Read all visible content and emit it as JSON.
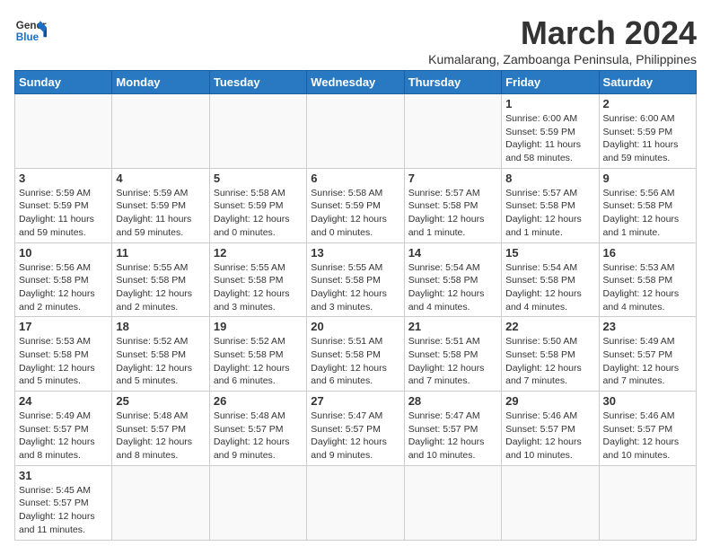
{
  "header": {
    "logo_general": "General",
    "logo_blue": "Blue",
    "title": "March 2024",
    "subtitle": "Kumalarang, Zamboanga Peninsula, Philippines"
  },
  "weekdays": [
    "Sunday",
    "Monday",
    "Tuesday",
    "Wednesday",
    "Thursday",
    "Friday",
    "Saturday"
  ],
  "weeks": [
    [
      {
        "day": "",
        "info": ""
      },
      {
        "day": "",
        "info": ""
      },
      {
        "day": "",
        "info": ""
      },
      {
        "day": "",
        "info": ""
      },
      {
        "day": "",
        "info": ""
      },
      {
        "day": "1",
        "info": "Sunrise: 6:00 AM\nSunset: 5:59 PM\nDaylight: 11 hours\nand 58 minutes."
      },
      {
        "day": "2",
        "info": "Sunrise: 6:00 AM\nSunset: 5:59 PM\nDaylight: 11 hours\nand 59 minutes."
      }
    ],
    [
      {
        "day": "3",
        "info": "Sunrise: 5:59 AM\nSunset: 5:59 PM\nDaylight: 11 hours\nand 59 minutes."
      },
      {
        "day": "4",
        "info": "Sunrise: 5:59 AM\nSunset: 5:59 PM\nDaylight: 11 hours\nand 59 minutes."
      },
      {
        "day": "5",
        "info": "Sunrise: 5:58 AM\nSunset: 5:59 PM\nDaylight: 12 hours\nand 0 minutes."
      },
      {
        "day": "6",
        "info": "Sunrise: 5:58 AM\nSunset: 5:59 PM\nDaylight: 12 hours\nand 0 minutes."
      },
      {
        "day": "7",
        "info": "Sunrise: 5:57 AM\nSunset: 5:58 PM\nDaylight: 12 hours\nand 1 minute."
      },
      {
        "day": "8",
        "info": "Sunrise: 5:57 AM\nSunset: 5:58 PM\nDaylight: 12 hours\nand 1 minute."
      },
      {
        "day": "9",
        "info": "Sunrise: 5:56 AM\nSunset: 5:58 PM\nDaylight: 12 hours\nand 1 minute."
      }
    ],
    [
      {
        "day": "10",
        "info": "Sunrise: 5:56 AM\nSunset: 5:58 PM\nDaylight: 12 hours\nand 2 minutes."
      },
      {
        "day": "11",
        "info": "Sunrise: 5:55 AM\nSunset: 5:58 PM\nDaylight: 12 hours\nand 2 minutes."
      },
      {
        "day": "12",
        "info": "Sunrise: 5:55 AM\nSunset: 5:58 PM\nDaylight: 12 hours\nand 3 minutes."
      },
      {
        "day": "13",
        "info": "Sunrise: 5:55 AM\nSunset: 5:58 PM\nDaylight: 12 hours\nand 3 minutes."
      },
      {
        "day": "14",
        "info": "Sunrise: 5:54 AM\nSunset: 5:58 PM\nDaylight: 12 hours\nand 4 minutes."
      },
      {
        "day": "15",
        "info": "Sunrise: 5:54 AM\nSunset: 5:58 PM\nDaylight: 12 hours\nand 4 minutes."
      },
      {
        "day": "16",
        "info": "Sunrise: 5:53 AM\nSunset: 5:58 PM\nDaylight: 12 hours\nand 4 minutes."
      }
    ],
    [
      {
        "day": "17",
        "info": "Sunrise: 5:53 AM\nSunset: 5:58 PM\nDaylight: 12 hours\nand 5 minutes."
      },
      {
        "day": "18",
        "info": "Sunrise: 5:52 AM\nSunset: 5:58 PM\nDaylight: 12 hours\nand 5 minutes."
      },
      {
        "day": "19",
        "info": "Sunrise: 5:52 AM\nSunset: 5:58 PM\nDaylight: 12 hours\nand 6 minutes."
      },
      {
        "day": "20",
        "info": "Sunrise: 5:51 AM\nSunset: 5:58 PM\nDaylight: 12 hours\nand 6 minutes."
      },
      {
        "day": "21",
        "info": "Sunrise: 5:51 AM\nSunset: 5:58 PM\nDaylight: 12 hours\nand 7 minutes."
      },
      {
        "day": "22",
        "info": "Sunrise: 5:50 AM\nSunset: 5:58 PM\nDaylight: 12 hours\nand 7 minutes."
      },
      {
        "day": "23",
        "info": "Sunrise: 5:49 AM\nSunset: 5:57 PM\nDaylight: 12 hours\nand 7 minutes."
      }
    ],
    [
      {
        "day": "24",
        "info": "Sunrise: 5:49 AM\nSunset: 5:57 PM\nDaylight: 12 hours\nand 8 minutes."
      },
      {
        "day": "25",
        "info": "Sunrise: 5:48 AM\nSunset: 5:57 PM\nDaylight: 12 hours\nand 8 minutes."
      },
      {
        "day": "26",
        "info": "Sunrise: 5:48 AM\nSunset: 5:57 PM\nDaylight: 12 hours\nand 9 minutes."
      },
      {
        "day": "27",
        "info": "Sunrise: 5:47 AM\nSunset: 5:57 PM\nDaylight: 12 hours\nand 9 minutes."
      },
      {
        "day": "28",
        "info": "Sunrise: 5:47 AM\nSunset: 5:57 PM\nDaylight: 12 hours\nand 10 minutes."
      },
      {
        "day": "29",
        "info": "Sunrise: 5:46 AM\nSunset: 5:57 PM\nDaylight: 12 hours\nand 10 minutes."
      },
      {
        "day": "30",
        "info": "Sunrise: 5:46 AM\nSunset: 5:57 PM\nDaylight: 12 hours\nand 10 minutes."
      }
    ],
    [
      {
        "day": "31",
        "info": "Sunrise: 5:45 AM\nSunset: 5:57 PM\nDaylight: 12 hours\nand 11 minutes."
      },
      {
        "day": "",
        "info": ""
      },
      {
        "day": "",
        "info": ""
      },
      {
        "day": "",
        "info": ""
      },
      {
        "day": "",
        "info": ""
      },
      {
        "day": "",
        "info": ""
      },
      {
        "day": "",
        "info": ""
      }
    ]
  ]
}
